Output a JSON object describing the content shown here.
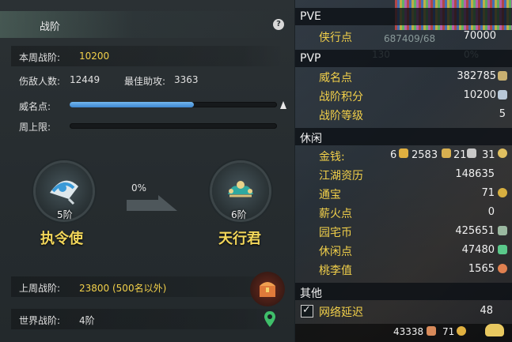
{
  "left": {
    "title": "战阶",
    "help": "?",
    "weekly_rank_label": "本周战阶:",
    "weekly_rank_value": "10200",
    "injured_label": "伤敌人数:",
    "injured_value": "12449",
    "best_assist_label": "最佳助攻:",
    "best_assist_value": "3363",
    "prestige_label": "威名点:",
    "prestige_progress": 0.6,
    "weekly_cap_label": "周上限:",
    "weekly_cap_progress": 0.0,
    "current_rank": {
      "level": "5阶",
      "name": "执令使"
    },
    "progress_percent": "0%",
    "next_rank": {
      "level": "6阶",
      "name": "天行君"
    },
    "last_week_label": "上周战阶:",
    "last_week_value": "23800 (500名以外)",
    "world_rank_label": "世界战阶:",
    "world_rank_value": "4阶"
  },
  "right": {
    "pve_header": "PVE",
    "pve_items": [
      {
        "label": "侠行点",
        "value": "70000"
      }
    ],
    "pvp_header": "PVP",
    "pvp_items": [
      {
        "label": "威名点",
        "value": "382785"
      },
      {
        "label": "战阶积分",
        "value": "10200"
      },
      {
        "label": "战阶等级",
        "value": "5"
      }
    ],
    "leisure_header": "休闲",
    "money_label": "金钱:",
    "money_values": [
      "6",
      "2583",
      "21",
      "31"
    ],
    "leisure_items": [
      {
        "label": "江湖资历",
        "value": "148635"
      },
      {
        "label": "通宝",
        "value": "71"
      },
      {
        "label": "薪火点",
        "value": "0"
      },
      {
        "label": "园宅币",
        "value": "425651"
      },
      {
        "label": "休闲点",
        "value": "47480"
      },
      {
        "label": "桃李值",
        "value": "1565"
      }
    ],
    "other_header": "其他",
    "network_label": "网络延迟",
    "network_value": "48",
    "bottom_value_1": "43338",
    "bottom_value_2": "71",
    "bg_hp_text": "687409/68",
    "bg_level_text": "130",
    "bg_percent_text": "0%"
  },
  "colors": {
    "gold": "#f2d04a",
    "bar_blue": "#3d86d0",
    "panel": "#2b3134"
  }
}
